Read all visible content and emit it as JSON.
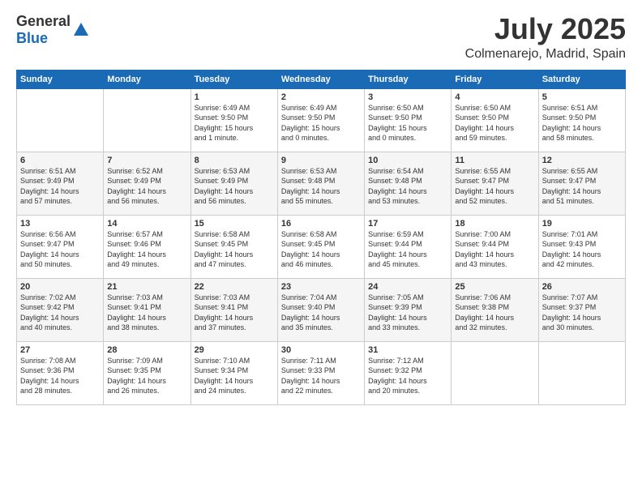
{
  "logo": {
    "text_general": "General",
    "text_blue": "Blue"
  },
  "header": {
    "month": "July 2025",
    "location": "Colmenarejo, Madrid, Spain"
  },
  "weekdays": [
    "Sunday",
    "Monday",
    "Tuesday",
    "Wednesday",
    "Thursday",
    "Friday",
    "Saturday"
  ],
  "weeks": [
    [
      {
        "day": "",
        "info": ""
      },
      {
        "day": "",
        "info": ""
      },
      {
        "day": "1",
        "info": "Sunrise: 6:49 AM\nSunset: 9:50 PM\nDaylight: 15 hours\nand 1 minute."
      },
      {
        "day": "2",
        "info": "Sunrise: 6:49 AM\nSunset: 9:50 PM\nDaylight: 15 hours\nand 0 minutes."
      },
      {
        "day": "3",
        "info": "Sunrise: 6:50 AM\nSunset: 9:50 PM\nDaylight: 15 hours\nand 0 minutes."
      },
      {
        "day": "4",
        "info": "Sunrise: 6:50 AM\nSunset: 9:50 PM\nDaylight: 14 hours\nand 59 minutes."
      },
      {
        "day": "5",
        "info": "Sunrise: 6:51 AM\nSunset: 9:50 PM\nDaylight: 14 hours\nand 58 minutes."
      }
    ],
    [
      {
        "day": "6",
        "info": "Sunrise: 6:51 AM\nSunset: 9:49 PM\nDaylight: 14 hours\nand 57 minutes."
      },
      {
        "day": "7",
        "info": "Sunrise: 6:52 AM\nSunset: 9:49 PM\nDaylight: 14 hours\nand 56 minutes."
      },
      {
        "day": "8",
        "info": "Sunrise: 6:53 AM\nSunset: 9:49 PM\nDaylight: 14 hours\nand 56 minutes."
      },
      {
        "day": "9",
        "info": "Sunrise: 6:53 AM\nSunset: 9:48 PM\nDaylight: 14 hours\nand 55 minutes."
      },
      {
        "day": "10",
        "info": "Sunrise: 6:54 AM\nSunset: 9:48 PM\nDaylight: 14 hours\nand 53 minutes."
      },
      {
        "day": "11",
        "info": "Sunrise: 6:55 AM\nSunset: 9:47 PM\nDaylight: 14 hours\nand 52 minutes."
      },
      {
        "day": "12",
        "info": "Sunrise: 6:55 AM\nSunset: 9:47 PM\nDaylight: 14 hours\nand 51 minutes."
      }
    ],
    [
      {
        "day": "13",
        "info": "Sunrise: 6:56 AM\nSunset: 9:47 PM\nDaylight: 14 hours\nand 50 minutes."
      },
      {
        "day": "14",
        "info": "Sunrise: 6:57 AM\nSunset: 9:46 PM\nDaylight: 14 hours\nand 49 minutes."
      },
      {
        "day": "15",
        "info": "Sunrise: 6:58 AM\nSunset: 9:45 PM\nDaylight: 14 hours\nand 47 minutes."
      },
      {
        "day": "16",
        "info": "Sunrise: 6:58 AM\nSunset: 9:45 PM\nDaylight: 14 hours\nand 46 minutes."
      },
      {
        "day": "17",
        "info": "Sunrise: 6:59 AM\nSunset: 9:44 PM\nDaylight: 14 hours\nand 45 minutes."
      },
      {
        "day": "18",
        "info": "Sunrise: 7:00 AM\nSunset: 9:44 PM\nDaylight: 14 hours\nand 43 minutes."
      },
      {
        "day": "19",
        "info": "Sunrise: 7:01 AM\nSunset: 9:43 PM\nDaylight: 14 hours\nand 42 minutes."
      }
    ],
    [
      {
        "day": "20",
        "info": "Sunrise: 7:02 AM\nSunset: 9:42 PM\nDaylight: 14 hours\nand 40 minutes."
      },
      {
        "day": "21",
        "info": "Sunrise: 7:03 AM\nSunset: 9:41 PM\nDaylight: 14 hours\nand 38 minutes."
      },
      {
        "day": "22",
        "info": "Sunrise: 7:03 AM\nSunset: 9:41 PM\nDaylight: 14 hours\nand 37 minutes."
      },
      {
        "day": "23",
        "info": "Sunrise: 7:04 AM\nSunset: 9:40 PM\nDaylight: 14 hours\nand 35 minutes."
      },
      {
        "day": "24",
        "info": "Sunrise: 7:05 AM\nSunset: 9:39 PM\nDaylight: 14 hours\nand 33 minutes."
      },
      {
        "day": "25",
        "info": "Sunrise: 7:06 AM\nSunset: 9:38 PM\nDaylight: 14 hours\nand 32 minutes."
      },
      {
        "day": "26",
        "info": "Sunrise: 7:07 AM\nSunset: 9:37 PM\nDaylight: 14 hours\nand 30 minutes."
      }
    ],
    [
      {
        "day": "27",
        "info": "Sunrise: 7:08 AM\nSunset: 9:36 PM\nDaylight: 14 hours\nand 28 minutes."
      },
      {
        "day": "28",
        "info": "Sunrise: 7:09 AM\nSunset: 9:35 PM\nDaylight: 14 hours\nand 26 minutes."
      },
      {
        "day": "29",
        "info": "Sunrise: 7:10 AM\nSunset: 9:34 PM\nDaylight: 14 hours\nand 24 minutes."
      },
      {
        "day": "30",
        "info": "Sunrise: 7:11 AM\nSunset: 9:33 PM\nDaylight: 14 hours\nand 22 minutes."
      },
      {
        "day": "31",
        "info": "Sunrise: 7:12 AM\nSunset: 9:32 PM\nDaylight: 14 hours\nand 20 minutes."
      },
      {
        "day": "",
        "info": ""
      },
      {
        "day": "",
        "info": ""
      }
    ]
  ]
}
